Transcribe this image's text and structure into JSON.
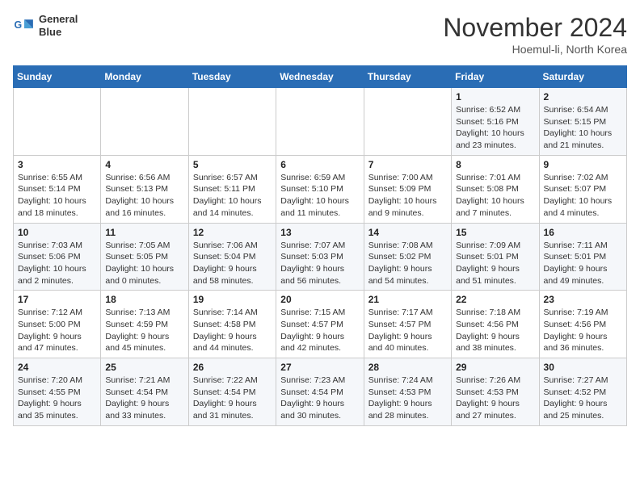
{
  "header": {
    "logo_line1": "General",
    "logo_line2": "Blue",
    "month": "November 2024",
    "location": "Hoemul-li, North Korea"
  },
  "weekdays": [
    "Sunday",
    "Monday",
    "Tuesday",
    "Wednesday",
    "Thursday",
    "Friday",
    "Saturday"
  ],
  "weeks": [
    [
      {
        "day": "",
        "info": ""
      },
      {
        "day": "",
        "info": ""
      },
      {
        "day": "",
        "info": ""
      },
      {
        "day": "",
        "info": ""
      },
      {
        "day": "",
        "info": ""
      },
      {
        "day": "1",
        "info": "Sunrise: 6:52 AM\nSunset: 5:16 PM\nDaylight: 10 hours\nand 23 minutes."
      },
      {
        "day": "2",
        "info": "Sunrise: 6:54 AM\nSunset: 5:15 PM\nDaylight: 10 hours\nand 21 minutes."
      }
    ],
    [
      {
        "day": "3",
        "info": "Sunrise: 6:55 AM\nSunset: 5:14 PM\nDaylight: 10 hours\nand 18 minutes."
      },
      {
        "day": "4",
        "info": "Sunrise: 6:56 AM\nSunset: 5:13 PM\nDaylight: 10 hours\nand 16 minutes."
      },
      {
        "day": "5",
        "info": "Sunrise: 6:57 AM\nSunset: 5:11 PM\nDaylight: 10 hours\nand 14 minutes."
      },
      {
        "day": "6",
        "info": "Sunrise: 6:59 AM\nSunset: 5:10 PM\nDaylight: 10 hours\nand 11 minutes."
      },
      {
        "day": "7",
        "info": "Sunrise: 7:00 AM\nSunset: 5:09 PM\nDaylight: 10 hours\nand 9 minutes."
      },
      {
        "day": "8",
        "info": "Sunrise: 7:01 AM\nSunset: 5:08 PM\nDaylight: 10 hours\nand 7 minutes."
      },
      {
        "day": "9",
        "info": "Sunrise: 7:02 AM\nSunset: 5:07 PM\nDaylight: 10 hours\nand 4 minutes."
      }
    ],
    [
      {
        "day": "10",
        "info": "Sunrise: 7:03 AM\nSunset: 5:06 PM\nDaylight: 10 hours\nand 2 minutes."
      },
      {
        "day": "11",
        "info": "Sunrise: 7:05 AM\nSunset: 5:05 PM\nDaylight: 10 hours\nand 0 minutes."
      },
      {
        "day": "12",
        "info": "Sunrise: 7:06 AM\nSunset: 5:04 PM\nDaylight: 9 hours\nand 58 minutes."
      },
      {
        "day": "13",
        "info": "Sunrise: 7:07 AM\nSunset: 5:03 PM\nDaylight: 9 hours\nand 56 minutes."
      },
      {
        "day": "14",
        "info": "Sunrise: 7:08 AM\nSunset: 5:02 PM\nDaylight: 9 hours\nand 54 minutes."
      },
      {
        "day": "15",
        "info": "Sunrise: 7:09 AM\nSunset: 5:01 PM\nDaylight: 9 hours\nand 51 minutes."
      },
      {
        "day": "16",
        "info": "Sunrise: 7:11 AM\nSunset: 5:01 PM\nDaylight: 9 hours\nand 49 minutes."
      }
    ],
    [
      {
        "day": "17",
        "info": "Sunrise: 7:12 AM\nSunset: 5:00 PM\nDaylight: 9 hours\nand 47 minutes."
      },
      {
        "day": "18",
        "info": "Sunrise: 7:13 AM\nSunset: 4:59 PM\nDaylight: 9 hours\nand 45 minutes."
      },
      {
        "day": "19",
        "info": "Sunrise: 7:14 AM\nSunset: 4:58 PM\nDaylight: 9 hours\nand 44 minutes."
      },
      {
        "day": "20",
        "info": "Sunrise: 7:15 AM\nSunset: 4:57 PM\nDaylight: 9 hours\nand 42 minutes."
      },
      {
        "day": "21",
        "info": "Sunrise: 7:17 AM\nSunset: 4:57 PM\nDaylight: 9 hours\nand 40 minutes."
      },
      {
        "day": "22",
        "info": "Sunrise: 7:18 AM\nSunset: 4:56 PM\nDaylight: 9 hours\nand 38 minutes."
      },
      {
        "day": "23",
        "info": "Sunrise: 7:19 AM\nSunset: 4:56 PM\nDaylight: 9 hours\nand 36 minutes."
      }
    ],
    [
      {
        "day": "24",
        "info": "Sunrise: 7:20 AM\nSunset: 4:55 PM\nDaylight: 9 hours\nand 35 minutes."
      },
      {
        "day": "25",
        "info": "Sunrise: 7:21 AM\nSunset: 4:54 PM\nDaylight: 9 hours\nand 33 minutes."
      },
      {
        "day": "26",
        "info": "Sunrise: 7:22 AM\nSunset: 4:54 PM\nDaylight: 9 hours\nand 31 minutes."
      },
      {
        "day": "27",
        "info": "Sunrise: 7:23 AM\nSunset: 4:54 PM\nDaylight: 9 hours\nand 30 minutes."
      },
      {
        "day": "28",
        "info": "Sunrise: 7:24 AM\nSunset: 4:53 PM\nDaylight: 9 hours\nand 28 minutes."
      },
      {
        "day": "29",
        "info": "Sunrise: 7:26 AM\nSunset: 4:53 PM\nDaylight: 9 hours\nand 27 minutes."
      },
      {
        "day": "30",
        "info": "Sunrise: 7:27 AM\nSunset: 4:52 PM\nDaylight: 9 hours\nand 25 minutes."
      }
    ]
  ]
}
